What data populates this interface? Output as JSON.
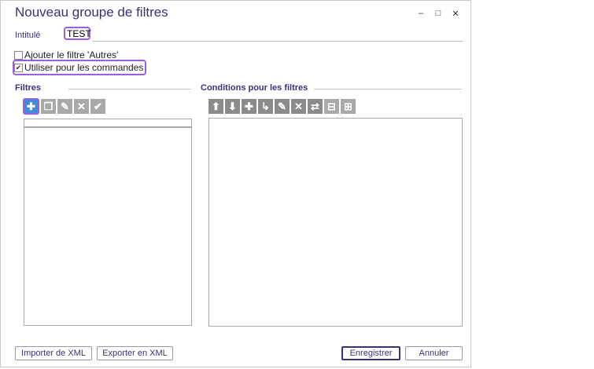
{
  "window": {
    "title": "Nouveau groupe de filtres",
    "minimize": "–",
    "maximize": "□",
    "close": "✕"
  },
  "form": {
    "intitule_label": "Intitulé",
    "intitule_value": "TEST",
    "checkbox_autres_label": "Ajouter le filtre 'Autres'",
    "checkbox_autres_checked": false,
    "checkbox_commandes_label": "Utiliser pour les commandes",
    "checkbox_commandes_checked": true
  },
  "filtres": {
    "title": "Filtres",
    "toolbar": [
      {
        "name": "add",
        "glyph": "✚"
      },
      {
        "name": "copy",
        "glyph": "❐"
      },
      {
        "name": "edit",
        "glyph": "✎"
      },
      {
        "name": "delete",
        "glyph": "✕"
      },
      {
        "name": "validate",
        "glyph": "✔"
      }
    ]
  },
  "conditions": {
    "title": "Conditions pour les filtres",
    "toolbar": [
      {
        "name": "move-up",
        "glyph": "⬆"
      },
      {
        "name": "move-down",
        "glyph": "⬇"
      },
      {
        "name": "add",
        "glyph": "✚"
      },
      {
        "name": "indent",
        "glyph": "↳"
      },
      {
        "name": "edit",
        "glyph": "✎"
      },
      {
        "name": "delete",
        "glyph": "✕"
      },
      {
        "name": "swap",
        "glyph": "⇄"
      },
      {
        "name": "collapse",
        "glyph": "⊟"
      },
      {
        "name": "expand",
        "glyph": "⊞"
      }
    ]
  },
  "footer": {
    "import_xml": "Importer de XML",
    "export_xml": "Exporter en XML",
    "save": "Enregistrer",
    "cancel": "Annuler"
  }
}
